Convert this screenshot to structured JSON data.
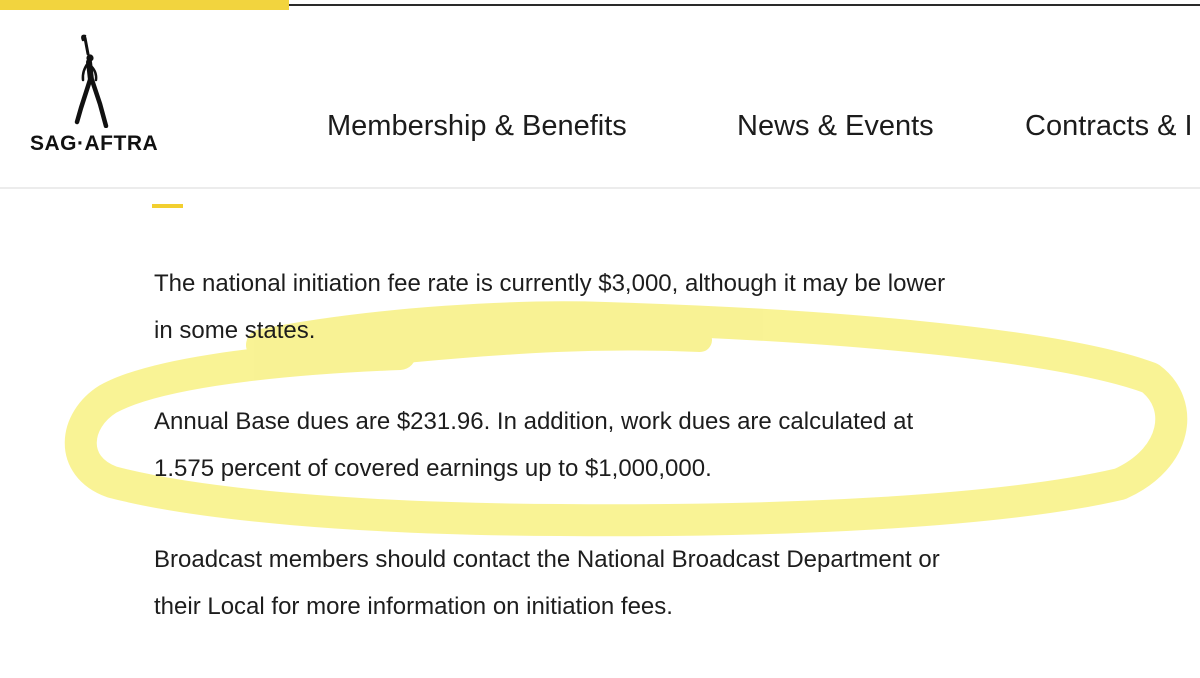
{
  "logo": {
    "wordmark": "SAG·AFTRA"
  },
  "nav": {
    "items": [
      {
        "label": "Membership & Benefits"
      },
      {
        "label": "News & Events"
      },
      {
        "label": "Contracts & I"
      }
    ]
  },
  "content": {
    "paragraphs": [
      {
        "lines": [
          "The national initiation fee rate is currently $3,000, although it may be lower",
          "in some states."
        ]
      },
      {
        "lines": [
          "Annual Base dues are $231.96. In addition, work dues are calculated at",
          "1.575 percent of covered earnings up to $1,000,000."
        ]
      },
      {
        "lines": [
          "Broadcast members should contact the National Broadcast Department or",
          "their Local for more information on initiation fees."
        ]
      }
    ]
  },
  "colors": {
    "accent_yellow": "#f2d43e",
    "highlighter": "#f7f07a",
    "text": "#1d1d1d",
    "background": "#ffffff"
  },
  "icons": {
    "logo_figure": "dancer-figure-icon"
  }
}
